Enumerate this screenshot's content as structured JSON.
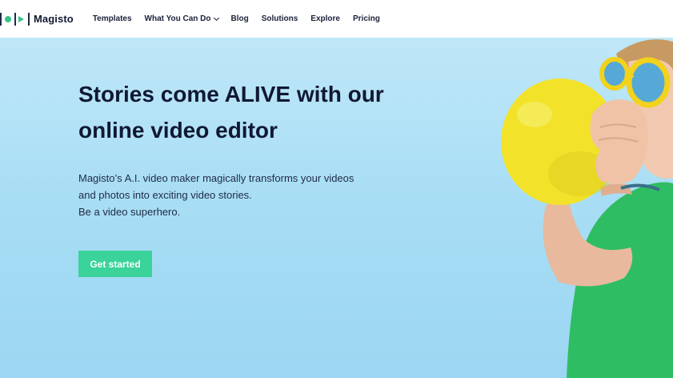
{
  "brand": {
    "name": "Magisto",
    "accent_color": "#35c48a",
    "logo_icons": [
      "bar-icon",
      "dot-icon",
      "play-icon",
      "bar-icon"
    ]
  },
  "nav": {
    "items": [
      {
        "label": "Templates"
      },
      {
        "label": "What You Can Do",
        "has_dropdown": true,
        "icon": "chevron-down-icon"
      },
      {
        "label": "Blog"
      },
      {
        "label": "Solutions"
      },
      {
        "label": "Explore"
      },
      {
        "label": "Pricing"
      }
    ]
  },
  "hero": {
    "title": "Stories come ALIVE with our online video editor",
    "description": [
      "Magisto’s A.I. video maker magically transforms your videos",
      "and photos into exciting video stories.",
      "Be a video superhero."
    ],
    "cta_label": "Get started",
    "cta_color": "#3ad39a",
    "background_color": "#a9def5"
  }
}
